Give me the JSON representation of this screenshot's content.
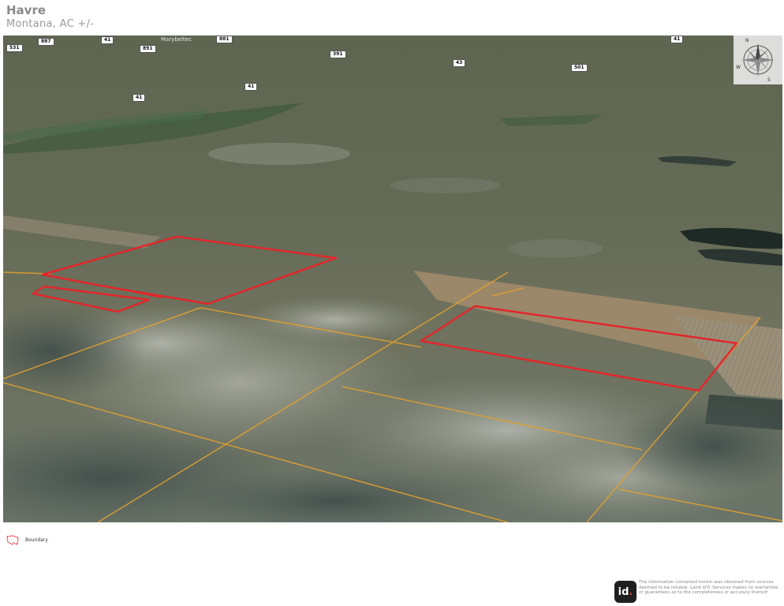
{
  "header": {
    "title": "Havre",
    "subtitle": "Montana,  AC +/-"
  },
  "map": {
    "road_shields": [
      {
        "label": "531"
      },
      {
        "label": "887"
      },
      {
        "label": "41"
      },
      {
        "label": "891"
      },
      {
        "label": "881"
      },
      {
        "label": "391"
      },
      {
        "label": "43"
      },
      {
        "label": "501"
      },
      {
        "label": "41"
      },
      {
        "label": "41"
      },
      {
        "label": "41"
      }
    ],
    "towns": [
      {
        "label": "Marybeltec"
      }
    ],
    "colors": {
      "boundary": "#e3262b",
      "section_lines": "#e0a030"
    },
    "compass_icon": "compass-rose-icon"
  },
  "legend": {
    "items": [
      {
        "label": "Boundary",
        "icon": "boundary-outline-icon",
        "color": "#e3262b"
      }
    ]
  },
  "footer": {
    "logo_text": "id",
    "logo_dot": ".",
    "disclaimer": "The information contained herein was obtained from sources deemed to be reliable. Land id® Services makes no warranties or guarantees as to the completeness or accuracy thereof."
  }
}
